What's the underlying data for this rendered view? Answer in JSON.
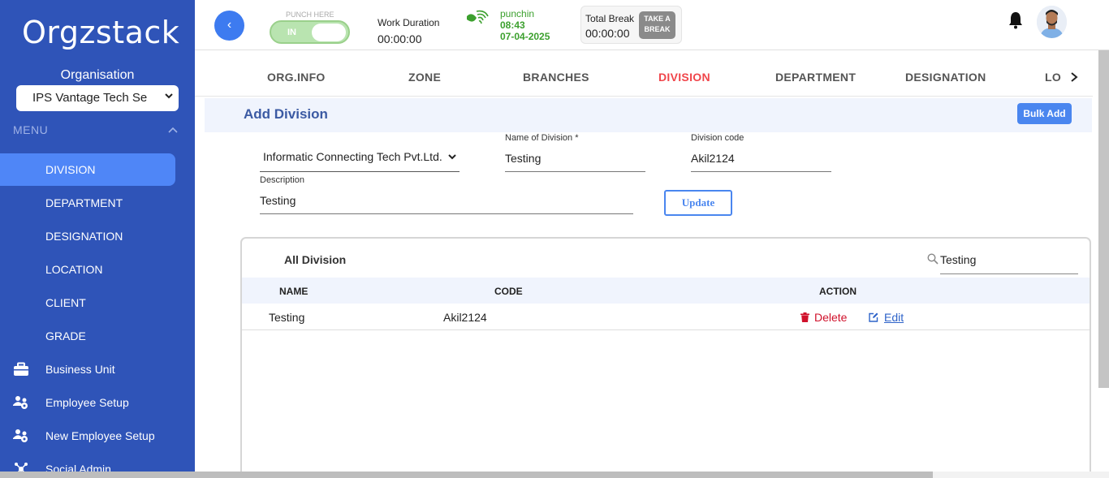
{
  "sidebar": {
    "logo": "Orgzstack",
    "organisation_label": "Organisation",
    "organisation_value": "IPS Vantage Tech Se",
    "menu_label": "MENU",
    "items": [
      {
        "label": "DIVISION",
        "active": true
      },
      {
        "label": "DEPARTMENT"
      },
      {
        "label": "DESIGNATION"
      },
      {
        "label": "LOCATION"
      },
      {
        "label": "CLIENT"
      },
      {
        "label": "GRADE"
      },
      {
        "label": "Business Unit",
        "icon": "briefcase-icon"
      },
      {
        "label": "Employee Setup",
        "icon": "users-gear-icon"
      },
      {
        "label": "New Employee Setup",
        "icon": "users-gear-icon"
      },
      {
        "label": "Social Admin",
        "icon": "social-icon"
      }
    ],
    "colors": {
      "background": "#2f54b8",
      "active": "#4f86f7"
    }
  },
  "topbar": {
    "back_label": "‹",
    "punch_here": "PUNCH HERE",
    "punch_toggle": "IN",
    "work_duration_label": "Work Duration",
    "work_duration_value": "00:00:00",
    "punch_status": "punchin",
    "punch_time": "08:43",
    "punch_date": "07-04-2025",
    "total_break_label": "Total Break",
    "total_break_value": "00:00:00",
    "take_break_line1": "TAKE A",
    "take_break_line2": "BREAK"
  },
  "tabs": [
    {
      "label": "ORG.INFO"
    },
    {
      "label": "ZONE"
    },
    {
      "label": "BRANCHES"
    },
    {
      "label": "DIVISION",
      "active": true
    },
    {
      "label": "DEPARTMENT"
    },
    {
      "label": "DESIGNATION"
    },
    {
      "label": "LO"
    }
  ],
  "form": {
    "title": "Add Division",
    "bulk_add": "Bulk Add",
    "company_value": "Informatic Connecting Tech Pvt.Ltd.",
    "name_label": "Name of Division  *",
    "name_value": "Testing",
    "code_label": "Division code",
    "code_value": "Akil2124",
    "description_label": "Description",
    "description_value": "Testing",
    "update_button": "Update"
  },
  "table": {
    "title": "All Division",
    "search_value": "Testing",
    "columns": [
      "NAME",
      "CODE",
      "ACTION"
    ],
    "rows": [
      {
        "name": "Testing",
        "code": "Akil2124"
      }
    ],
    "delete_label": "Delete",
    "edit_label": "Edit"
  }
}
